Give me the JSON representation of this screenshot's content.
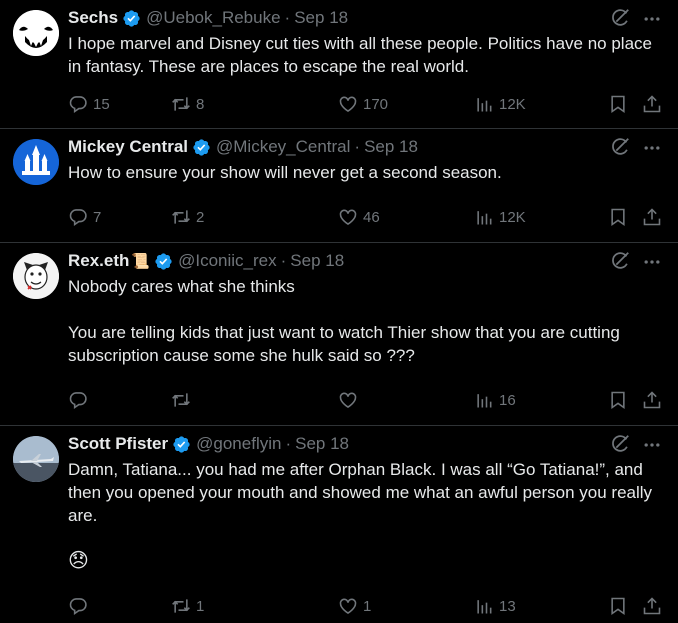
{
  "tweets": [
    {
      "name": "Sechs",
      "handle": "@Uebok_Rebuke",
      "date": "Sep 18",
      "verified": true,
      "body": [
        "I hope marvel and Disney cut ties with all these people. Politics have no place in fantasy. These are places to escape the real world."
      ],
      "replies": "15",
      "reposts": "8",
      "likes": "170",
      "views": "12K",
      "avatar": "ghost-face-avatar"
    },
    {
      "name": "Mickey Central",
      "handle": "@Mickey_Central",
      "date": "Sep 18",
      "verified": true,
      "body": [
        "How to ensure your show will never get a second season."
      ],
      "replies": "7",
      "reposts": "2",
      "likes": "46",
      "views": "12K",
      "avatar": "castle-avatar"
    },
    {
      "name": "Rex.eth",
      "badge": "📜",
      "handle": "@Iconiic_rex",
      "date": "Sep 18",
      "verified": true,
      "body": [
        "Nobody cares what she thinks",
        "You are telling kids that just want to watch Thier show that you are cutting subscription cause some she hulk said so ???"
      ],
      "replies": "",
      "reposts": "",
      "likes": "",
      "views": "16",
      "avatar": "skull-cartoon-avatar"
    },
    {
      "name": "Scott Pfister",
      "handle": "@goneflyin",
      "date": "Sep 18",
      "verified": true,
      "body": [
        "Damn, Tatiana... you had me after Orphan Black. I was all “Go Tatiana!”, and then you opened your mouth and showed me what an awful person you really are.",
        "😞"
      ],
      "replies": "",
      "reposts": "1",
      "likes": "1",
      "views": "13",
      "avatar": "airplane-avatar"
    }
  ],
  "colors": {
    "background": "#000000",
    "text": "#e7e9ea",
    "muted": "#71767b",
    "verified": "#1d9bf0",
    "divider": "#2f3336"
  }
}
